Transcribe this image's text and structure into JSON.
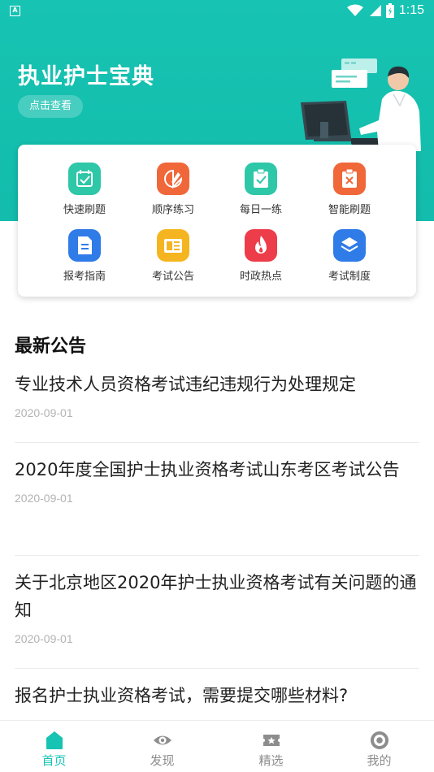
{
  "status_bar": {
    "time": "1:15",
    "notification_icon": "A"
  },
  "header": {
    "title": "执业护士宝典",
    "view_button": "点击查看"
  },
  "quick_menu": [
    {
      "label": "快速刷题",
      "icon": "calendar-check-icon",
      "color": "#2ec7a8"
    },
    {
      "label": "顺序练习",
      "icon": "edit-tag-icon",
      "color": "#f0673a"
    },
    {
      "label": "每日一练",
      "icon": "clipboard-check-icon",
      "color": "#2ec7a8"
    },
    {
      "label": "智能刷题",
      "icon": "clipboard-x-icon",
      "color": "#f0673a"
    },
    {
      "label": "报考指南",
      "icon": "document-icon",
      "color": "#2f7be8"
    },
    {
      "label": "考试公告",
      "icon": "newspaper-icon",
      "color": "#f5b520"
    },
    {
      "label": "时政热点",
      "icon": "flame-icon",
      "color": "#ee3d4a"
    },
    {
      "label": "考试制度",
      "icon": "layers-icon",
      "color": "#2f7be8"
    }
  ],
  "news_section": {
    "title": "最新公告",
    "items": [
      {
        "title": "专业技术人员资格考试违纪违规行为处理规定",
        "date": "2020-09-01"
      },
      {
        "title": "2020年度全国护士执业资格考试山东考区考试公告",
        "date": "2020-09-01"
      },
      {
        "title": "关于北京地区2020年护士执业资格考试有关问题的通知",
        "date": "2020-09-01"
      },
      {
        "title": "报名护士执业资格考试，需要提交哪些材料?",
        "date": ""
      }
    ]
  },
  "tab_bar": {
    "active_color": "#17c3b2",
    "tabs": [
      {
        "label": "首页",
        "icon": "home-icon",
        "active": true
      },
      {
        "label": "发现",
        "icon": "eye-icon",
        "active": false
      },
      {
        "label": "精选",
        "icon": "ticket-star-icon",
        "active": false
      },
      {
        "label": "我的",
        "icon": "profile-circle-icon",
        "active": false
      }
    ]
  }
}
